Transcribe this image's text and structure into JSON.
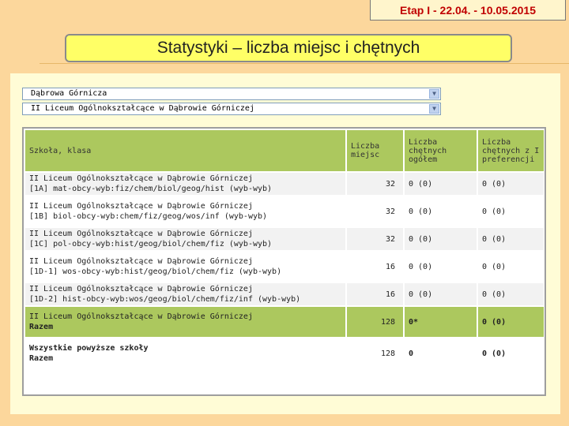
{
  "header": {
    "etap": "Etap I - 22.04. - 10.05.2015",
    "title": "Statystyki – liczba miejsc i chętnych"
  },
  "filters": {
    "city": "Dąbrowa Górnicza",
    "school": "II Liceum Ogólnokształcące w Dąbrowie Górniczej"
  },
  "table": {
    "headers": {
      "school_class": "Szkoła, klasa",
      "places": "Liczba miejsc",
      "applicants": "Liczba chętnych ogółem",
      "applicants_first": "Liczba chętnych z I preferencji"
    },
    "rows": [
      {
        "school": "II Liceum Ogólnokształcące w Dąbrowie Górniczej",
        "class": "[1A] mat-obcy-wyb:fiz/chem/biol/geog/hist (wyb-wyb)",
        "places": "32",
        "applicants": "0 (0)",
        "first": "0 (0)"
      },
      {
        "school": "II Liceum Ogólnokształcące w Dąbrowie Górniczej",
        "class": "[1B] biol-obcy-wyb:chem/fiz/geog/wos/inf (wyb-wyb)",
        "places": "32",
        "applicants": "0 (0)",
        "first": "0 (0)"
      },
      {
        "school": "II Liceum Ogólnokształcące w Dąbrowie Górniczej",
        "class": "[1C] pol-obcy-wyb:hist/geog/biol/chem/fiz (wyb-wyb)",
        "places": "32",
        "applicants": "0 (0)",
        "first": "0 (0)"
      },
      {
        "school": "II Liceum Ogólnokształcące w Dąbrowie Górniczej",
        "class": "[1D-1] wos-obcy-wyb:hist/geog/biol/chem/fiz (wyb-wyb)",
        "places": "16",
        "applicants": "0 (0)",
        "first": "0 (0)"
      },
      {
        "school": "II Liceum Ogólnokształcące w Dąbrowie Górniczej",
        "class": "[1D-2] hist-obcy-wyb:wos/geog/biol/chem/fiz/inf (wyb-wyb)",
        "places": "16",
        "applicants": "0 (0)",
        "first": "0 (0)"
      }
    ],
    "total_school": {
      "line1": "II Liceum Ogólnokształcące w Dąbrowie Górniczej",
      "line2": "Razem",
      "places": "128",
      "applicants": "0*",
      "first": "0 (0)"
    },
    "total_all": {
      "line1": "Wszystkie powyższe szkoły",
      "line2": "Razem",
      "places": "128",
      "applicants": "0",
      "first": "0 (0)"
    }
  },
  "colors": {
    "background": "#fcd79c",
    "header_green": "#acc85e",
    "title_yellow": "#ffff66",
    "etap_red": "#c00000"
  }
}
